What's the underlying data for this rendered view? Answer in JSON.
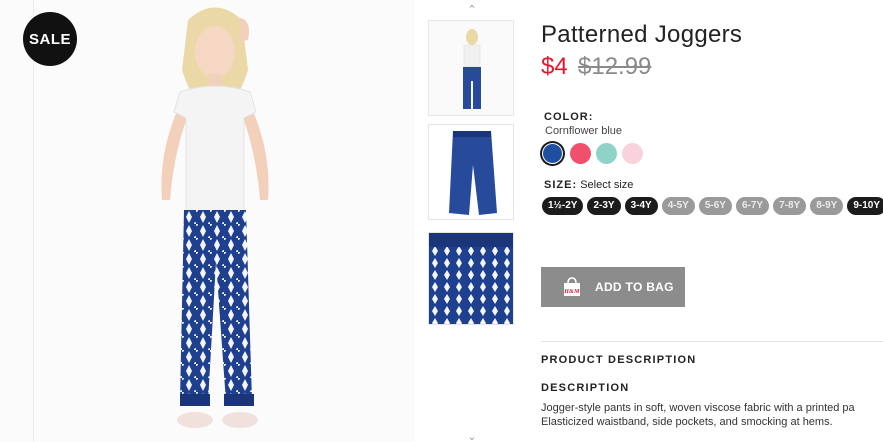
{
  "badge": {
    "text": "SALE"
  },
  "product": {
    "title": "Patterned Joggers",
    "price_now": "$4",
    "price_was": "$12.99"
  },
  "color": {
    "label": "COLOR:",
    "selected": "Cornflower blue",
    "swatches": [
      {
        "name": "cornflower-blue",
        "hex": "#1f4fa0"
      },
      {
        "name": "pink",
        "hex": "#f0506e"
      },
      {
        "name": "mint",
        "hex": "#8fd3c8"
      },
      {
        "name": "light-pink",
        "hex": "#f9d3d9"
      }
    ]
  },
  "size": {
    "label": "SIZE:",
    "prompt": "Select size",
    "options": [
      {
        "label": "1½-2Y",
        "available": true
      },
      {
        "label": "2-3Y",
        "available": true
      },
      {
        "label": "3-4Y",
        "available": true
      },
      {
        "label": "4-5Y",
        "available": false
      },
      {
        "label": "5-6Y",
        "available": false
      },
      {
        "label": "6-7Y",
        "available": false
      },
      {
        "label": "7-8Y",
        "available": false
      },
      {
        "label": "8-9Y",
        "available": false
      },
      {
        "label": "9-10Y",
        "available": true
      }
    ]
  },
  "cart": {
    "button_label": "ADD TO BAG",
    "icon": "shopping-bag-icon",
    "icon_text": "H&M"
  },
  "description": {
    "section_title": "PRODUCT DESCRIPTION",
    "heading": "DESCRIPTION",
    "line1": "Jogger-style pants in soft, woven viscose fabric with a printed pa",
    "line2": "Elasticized waistband, side pockets, and smocking at hems."
  },
  "thumbnails": {
    "up_icon": "chevron-up-icon",
    "down_icon": "chevron-down-icon",
    "items": [
      "model-view",
      "flat-view",
      "detail-view"
    ]
  },
  "colors": {
    "accent_price": "#e4162f",
    "button": "#8c8c8c",
    "pattern_blue": "#1f3f8f"
  }
}
